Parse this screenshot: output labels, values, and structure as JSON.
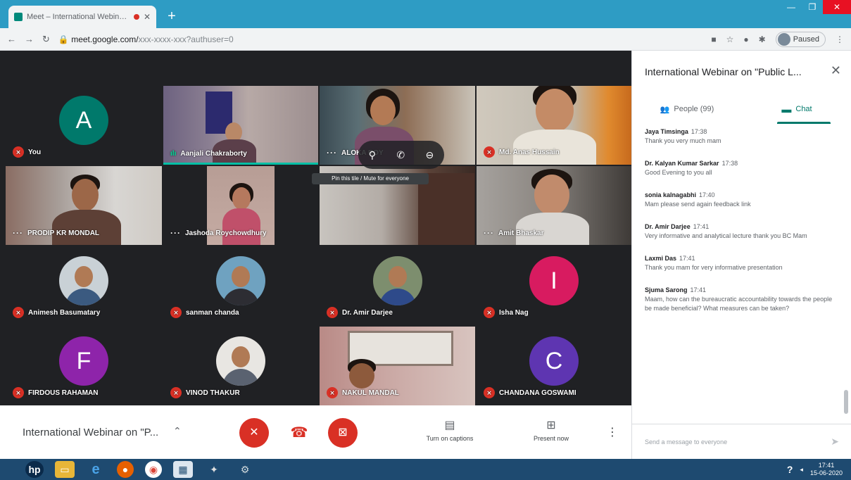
{
  "browser": {
    "tab_title": "Meet – International Webin…",
    "url_host": "meet.google.com/",
    "url_path": "xxx-xxxx-xxx?authuser=0",
    "profile_label": "Paused"
  },
  "participants": [
    {
      "name": "You",
      "type": "letter",
      "letter": "A",
      "color": "#00796b",
      "muted": true
    },
    {
      "name": "Aanjali Chakraborty",
      "type": "video",
      "muted": false,
      "speaking": true
    },
    {
      "name": "ALOKA ROY",
      "type": "video",
      "muted": false
    },
    {
      "name": "Md. Anas Hussain",
      "type": "video",
      "muted": true
    },
    {
      "name": "PRODIP KR MONDAL",
      "type": "video",
      "muted": false
    },
    {
      "name": "Jashoda Roychowdhury",
      "type": "video",
      "muted": false
    },
    {
      "name": "",
      "type": "video",
      "muted": false
    },
    {
      "name": "Amit Bhaskar",
      "type": "video",
      "muted": false
    },
    {
      "name": "Animesh Basumatary",
      "type": "photo",
      "muted": true
    },
    {
      "name": "sanman chanda",
      "type": "photo",
      "muted": true
    },
    {
      "name": "Dr. Amir Darjee",
      "type": "photo",
      "muted": true
    },
    {
      "name": "Isha Nag",
      "type": "letter",
      "letter": "I",
      "color": "#d81b60",
      "muted": true
    },
    {
      "name": "FIRDOUS RAHAMAN",
      "type": "letter",
      "letter": "F",
      "color": "#8e24aa",
      "muted": true
    },
    {
      "name": "VINOD THAKUR",
      "type": "photo",
      "muted": true
    },
    {
      "name": "NAKUL MANDAL",
      "type": "video",
      "muted": true
    },
    {
      "name": "CHANDANA GOSWAMI",
      "type": "letter",
      "letter": "C",
      "color": "#5e35b1",
      "muted": true
    }
  ],
  "tile_tooltip": "Pin this tile / Mute for everyone",
  "bottom": {
    "meeting_title": "International Webinar on \"P...",
    "captions_label": "Turn on captions",
    "present_label": "Present now"
  },
  "panel": {
    "title": "International Webinar on \"Public L...",
    "people_tab": "People (99)",
    "chat_tab": "Chat",
    "compose_placeholder": "Send a message to everyone",
    "messages": [
      {
        "sender": "Jaya Timsinga",
        "time": "17:38",
        "text": "Thank you very much mam"
      },
      {
        "sender": "Dr. Kalyan Kumar Sarkar",
        "time": "17:38",
        "text": "Good Evening to you all"
      },
      {
        "sender": "sonia kalnagabhi",
        "time": "17:40",
        "text": "Mam please send again feedback link"
      },
      {
        "sender": "Dr. Amir Darjee",
        "time": "17:41",
        "text": "Very informative and analytical lecture thank you BC Mam"
      },
      {
        "sender": "Laxmi Das",
        "time": "17:41",
        "text": "Thank you mam for very informative presentation"
      },
      {
        "sender": "Sjuma Sarong",
        "time": "17:41",
        "text": "Maam, how can the bureaucratic accountability towards the people be made beneficial? What measures can be taken?"
      }
    ]
  },
  "taskbar": {
    "time": "17:41",
    "date": "15-06-2020"
  }
}
